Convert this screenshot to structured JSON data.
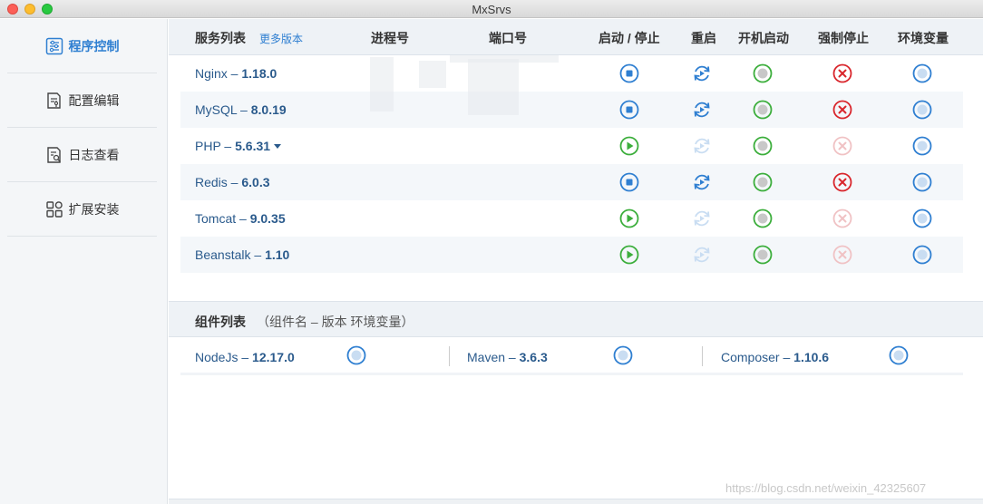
{
  "window": {
    "title": "MxSrvs"
  },
  "sidebar": {
    "items": [
      {
        "label": "程序控制",
        "icon": "program-control-icon",
        "active": true
      },
      {
        "label": "配置编辑",
        "icon": "config-edit-icon",
        "active": false
      },
      {
        "label": "日志查看",
        "icon": "log-view-icon",
        "active": false
      },
      {
        "label": "扩展安装",
        "icon": "extension-install-icon",
        "active": false
      }
    ]
  },
  "services": {
    "headers": {
      "list": "服务列表",
      "more_versions": "更多版本",
      "pid": "进程号",
      "port": "端口号",
      "start_stop": "启动 / 停止",
      "restart": "重启",
      "autostart": "开机启动",
      "force_stop": "强制停止",
      "env": "环境变量"
    },
    "rows": [
      {
        "name": "Nginx",
        "sep": " – ",
        "version": "1.18.0",
        "running": true,
        "has_dropdown": false
      },
      {
        "name": "MySQL",
        "sep": " – ",
        "version": "8.0.19",
        "running": true,
        "has_dropdown": false
      },
      {
        "name": "PHP",
        "sep": " – ",
        "version": "5.6.31",
        "running": false,
        "has_dropdown": true
      },
      {
        "name": "Redis",
        "sep": " – ",
        "version": "6.0.3",
        "running": true,
        "has_dropdown": false
      },
      {
        "name": "Tomcat",
        "sep": " – ",
        "version": "9.0.35",
        "running": false,
        "has_dropdown": false
      },
      {
        "name": "Beanstalk",
        "sep": " – ",
        "version": "1.10",
        "running": false,
        "has_dropdown": false
      }
    ]
  },
  "components": {
    "title": "组件列表",
    "subtitle": "（组件名 – 版本 环境变量）",
    "items": [
      {
        "name": "NodeJs",
        "sep": " – ",
        "version": "12.17.0"
      },
      {
        "name": "Maven",
        "sep": " – ",
        "version": "3.6.3"
      },
      {
        "name": "Composer",
        "sep": " – ",
        "version": "1.10.6"
      }
    ]
  },
  "watermark": "https://blog.csdn.net/weixin_42325607",
  "colors": {
    "accent_blue": "#2f7fd1",
    "green": "#3cae3c",
    "red": "#d9262c",
    "faded_blue": "#c9ddf2",
    "faded_red": "#f0c2c4"
  }
}
